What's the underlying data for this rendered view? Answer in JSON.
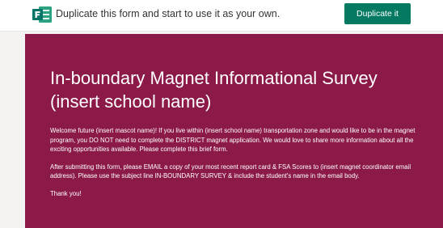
{
  "banner": {
    "message": "Duplicate this form and start to use it as your own.",
    "button_label": "Duplicate it",
    "logo_icon": "microsoft-forms-logo-icon",
    "button_color": "#047a63"
  },
  "form": {
    "title": "In-boundary Magnet Informational Survey (insert school name)",
    "paragraphs": [
      "Welcome future  (insert mascot name)! If you live within (insert school name) transportation zone and would like to be in the magnet program, you DO NOT need to complete the DISTRICT magnet application.  We would love to share more information about all the exciting opportunities available.  Please complete this brief form.",
      "After submitting this form, please EMAIL a copy of your most recent report card & FSA Scores to (insert magnet coordinator email address).  Please use the subject line IN-BOUNDARY SURVEY & include the student's name in the email body.",
      "Thank you!"
    ],
    "theme_color": "#8b1a48"
  }
}
